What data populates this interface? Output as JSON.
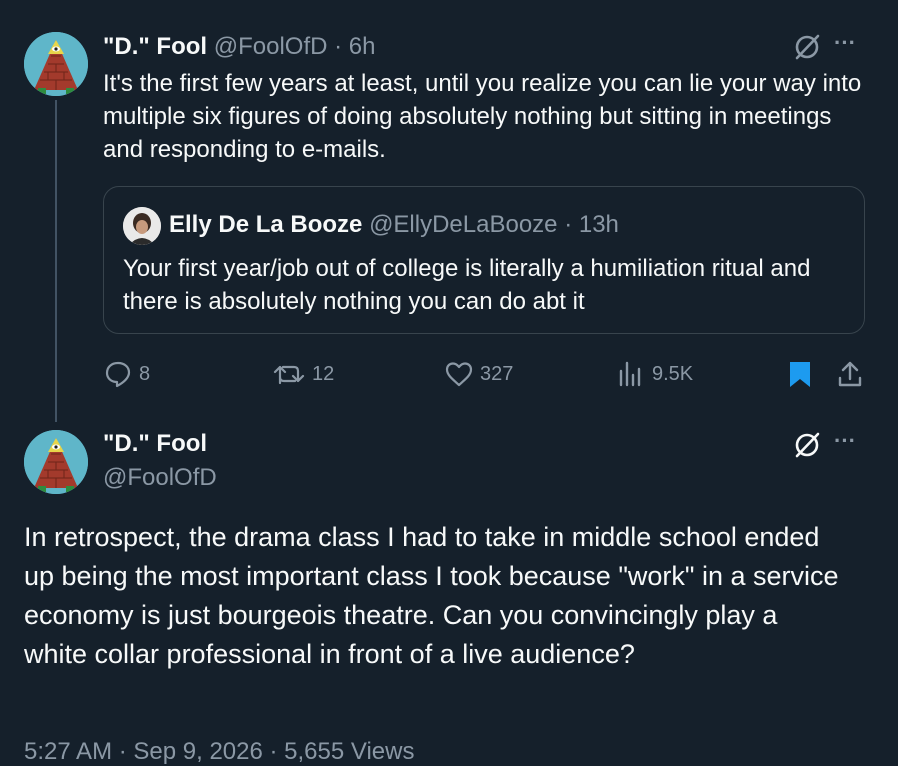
{
  "tweet1": {
    "display_name": "\"D.\" Fool",
    "handle_time": "@FoolOfD · 6h",
    "text": "It's the first few years at least, until you realize you can lie your way into multiple six figures of doing absolutely nothing but sitting in meetings and responding to e-mails.",
    "more_label": "···",
    "quote": {
      "display_name": "Elly De La Booze",
      "handle_time": "@EllyDeLaBooze · 13h",
      "text": "Your first year/job out of college is literally a humiliation ritual and there is absolutely nothing you can do abt it"
    },
    "actions": {
      "replies": "8",
      "reposts": "12",
      "likes": "327",
      "views": "9.5K"
    }
  },
  "tweet2": {
    "display_name": "\"D.\" Fool",
    "handle": "@FoolOfD",
    "more_label": "···",
    "text": "In retrospect, the drama class I had to take in middle school ended up being the most important class I took because \"work\" in a service economy is just bourgeois theatre. Can you convincingly play a white collar professional in front of a live audience?",
    "footer_partial": "5:27 AM · Sep 9, 2026 · 5,655 Views"
  },
  "colors": {
    "background": "#15202b",
    "text": "#f7f9f9",
    "muted": "#8b98a5",
    "border": "#38444d",
    "bookmark": "#1d9bf0"
  }
}
